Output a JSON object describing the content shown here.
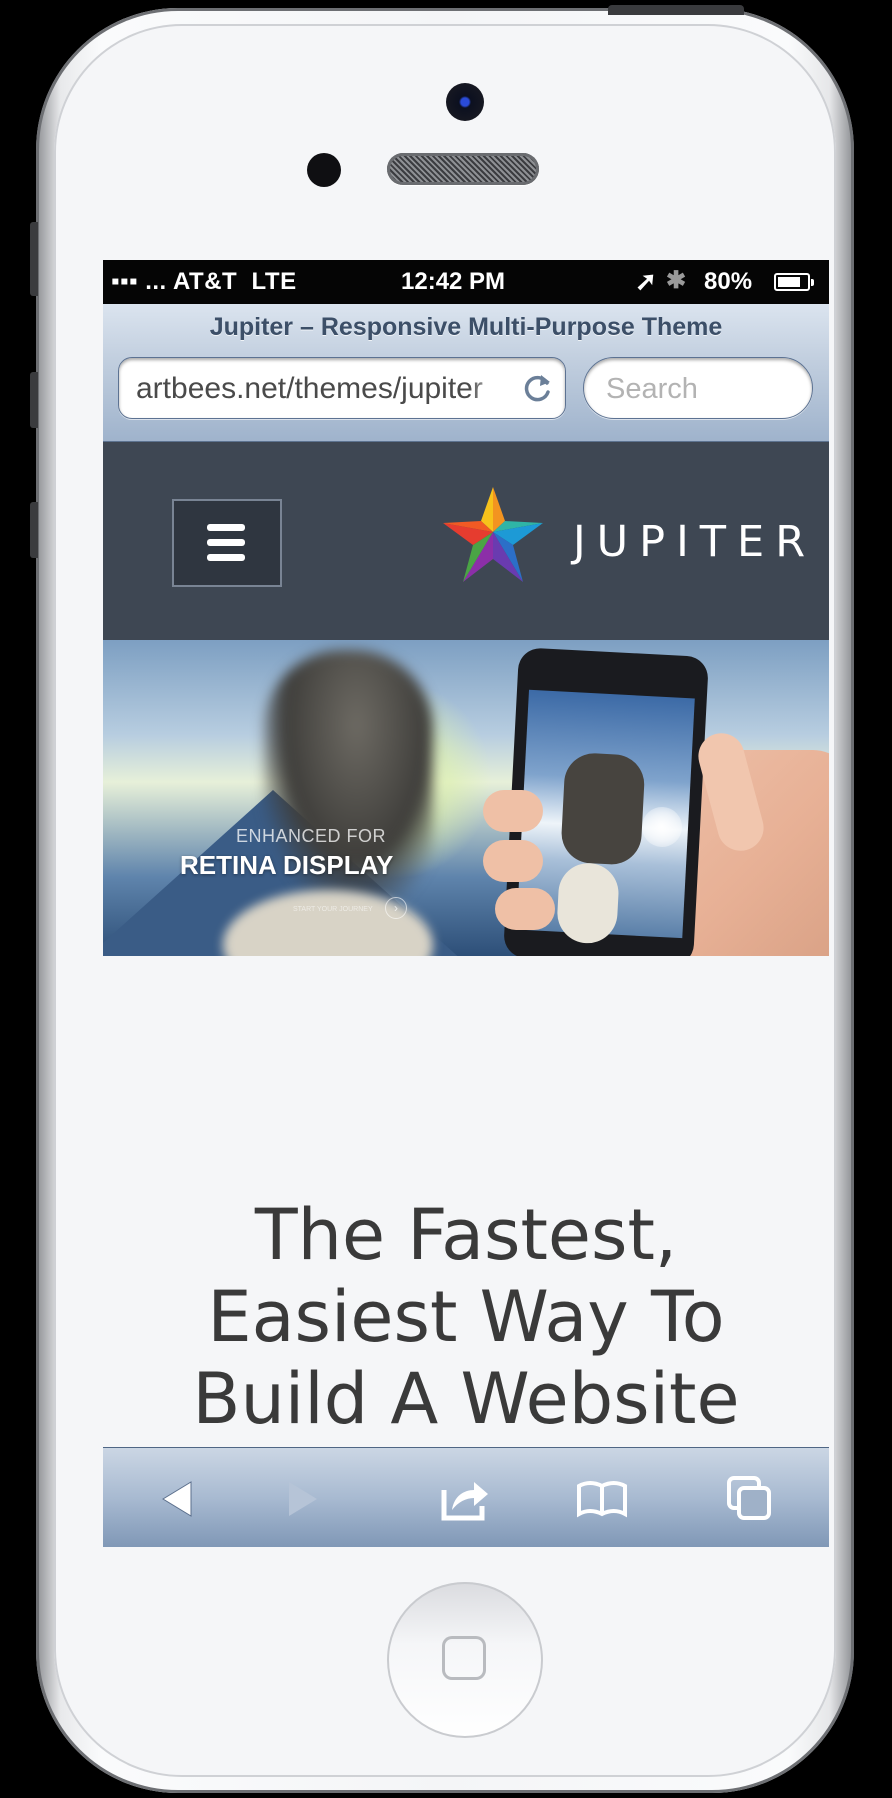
{
  "status_bar": {
    "carrier": "AT&T",
    "network": "LTE",
    "time": "12:42 PM",
    "battery": "80%",
    "battery_level": 0.8
  },
  "browser": {
    "page_title": "Jupiter – Responsive Multi-Purpose Theme",
    "url": "artbees.net/themes/jupiter",
    "search_placeholder": "Search"
  },
  "site_header": {
    "logo_text": "JUPITER",
    "menu_icon": "hamburger-icon"
  },
  "hero": {
    "kicker": "ENHANCED FOR",
    "title": "RETINA DISPLAY",
    "cta": "START YOUR JOURNEY"
  },
  "headline": {
    "line1": "The Fastest,",
    "line2": "Easiest Way To",
    "line3": "Build A Website"
  },
  "toolbar": {
    "items": [
      "back-icon",
      "forward-icon",
      "share-icon",
      "bookmarks-icon",
      "tabs-icon"
    ]
  },
  "colors": {
    "header_bg": "#3e4753",
    "status_bg": "#050505",
    "toolbar_accent": "#8ea3c0"
  }
}
